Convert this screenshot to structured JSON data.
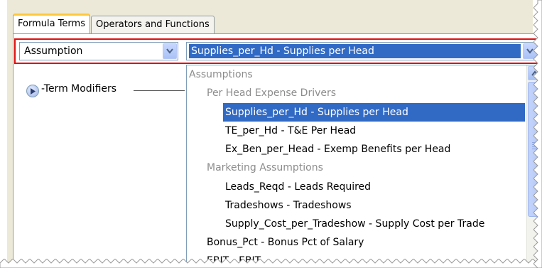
{
  "tabs": [
    {
      "label": "Formula Terms",
      "active": true
    },
    {
      "label": "Operators and Functions",
      "active": false
    }
  ],
  "term_type_select": {
    "value": "Assumption"
  },
  "term_select": {
    "value": "Supplies_per_Hd - Supplies per Head"
  },
  "term_modifiers": {
    "label": "-Term Modifiers"
  },
  "dropdown": {
    "items": [
      {
        "text": "Assumptions",
        "level": 0,
        "kind": "group"
      },
      {
        "text": "Per Head Expense Drivers",
        "level": 1,
        "kind": "group"
      },
      {
        "text": "Supplies_per_Hd - Supplies per Head",
        "level": 2,
        "kind": "option",
        "selected": true
      },
      {
        "text": "TE_per_Hd - T&E Per Head",
        "level": 2,
        "kind": "option"
      },
      {
        "text": "Ex_Ben_per_Head - Exemp Benefits per Head",
        "level": 2,
        "kind": "option"
      },
      {
        "text": "Marketing Assumptions",
        "level": 1,
        "kind": "group"
      },
      {
        "text": "Leads_Reqd - Leads Required",
        "level": 2,
        "kind": "option"
      },
      {
        "text": "Tradeshows - Tradeshows",
        "level": 2,
        "kind": "option"
      },
      {
        "text": "Supply_Cost_per_Tradeshow - Supply Cost per Trade",
        "level": 2,
        "kind": "option"
      },
      {
        "text": "Bonus_Pct - Bonus Pct of Salary",
        "level": 1,
        "kind": "option"
      },
      {
        "text": "EBIT - EBIT",
        "level": 1,
        "kind": "option"
      }
    ]
  },
  "colors": {
    "highlight": "#316ac5",
    "annotation_frame": "#e01010",
    "tab_accent": "#ffc83c"
  }
}
